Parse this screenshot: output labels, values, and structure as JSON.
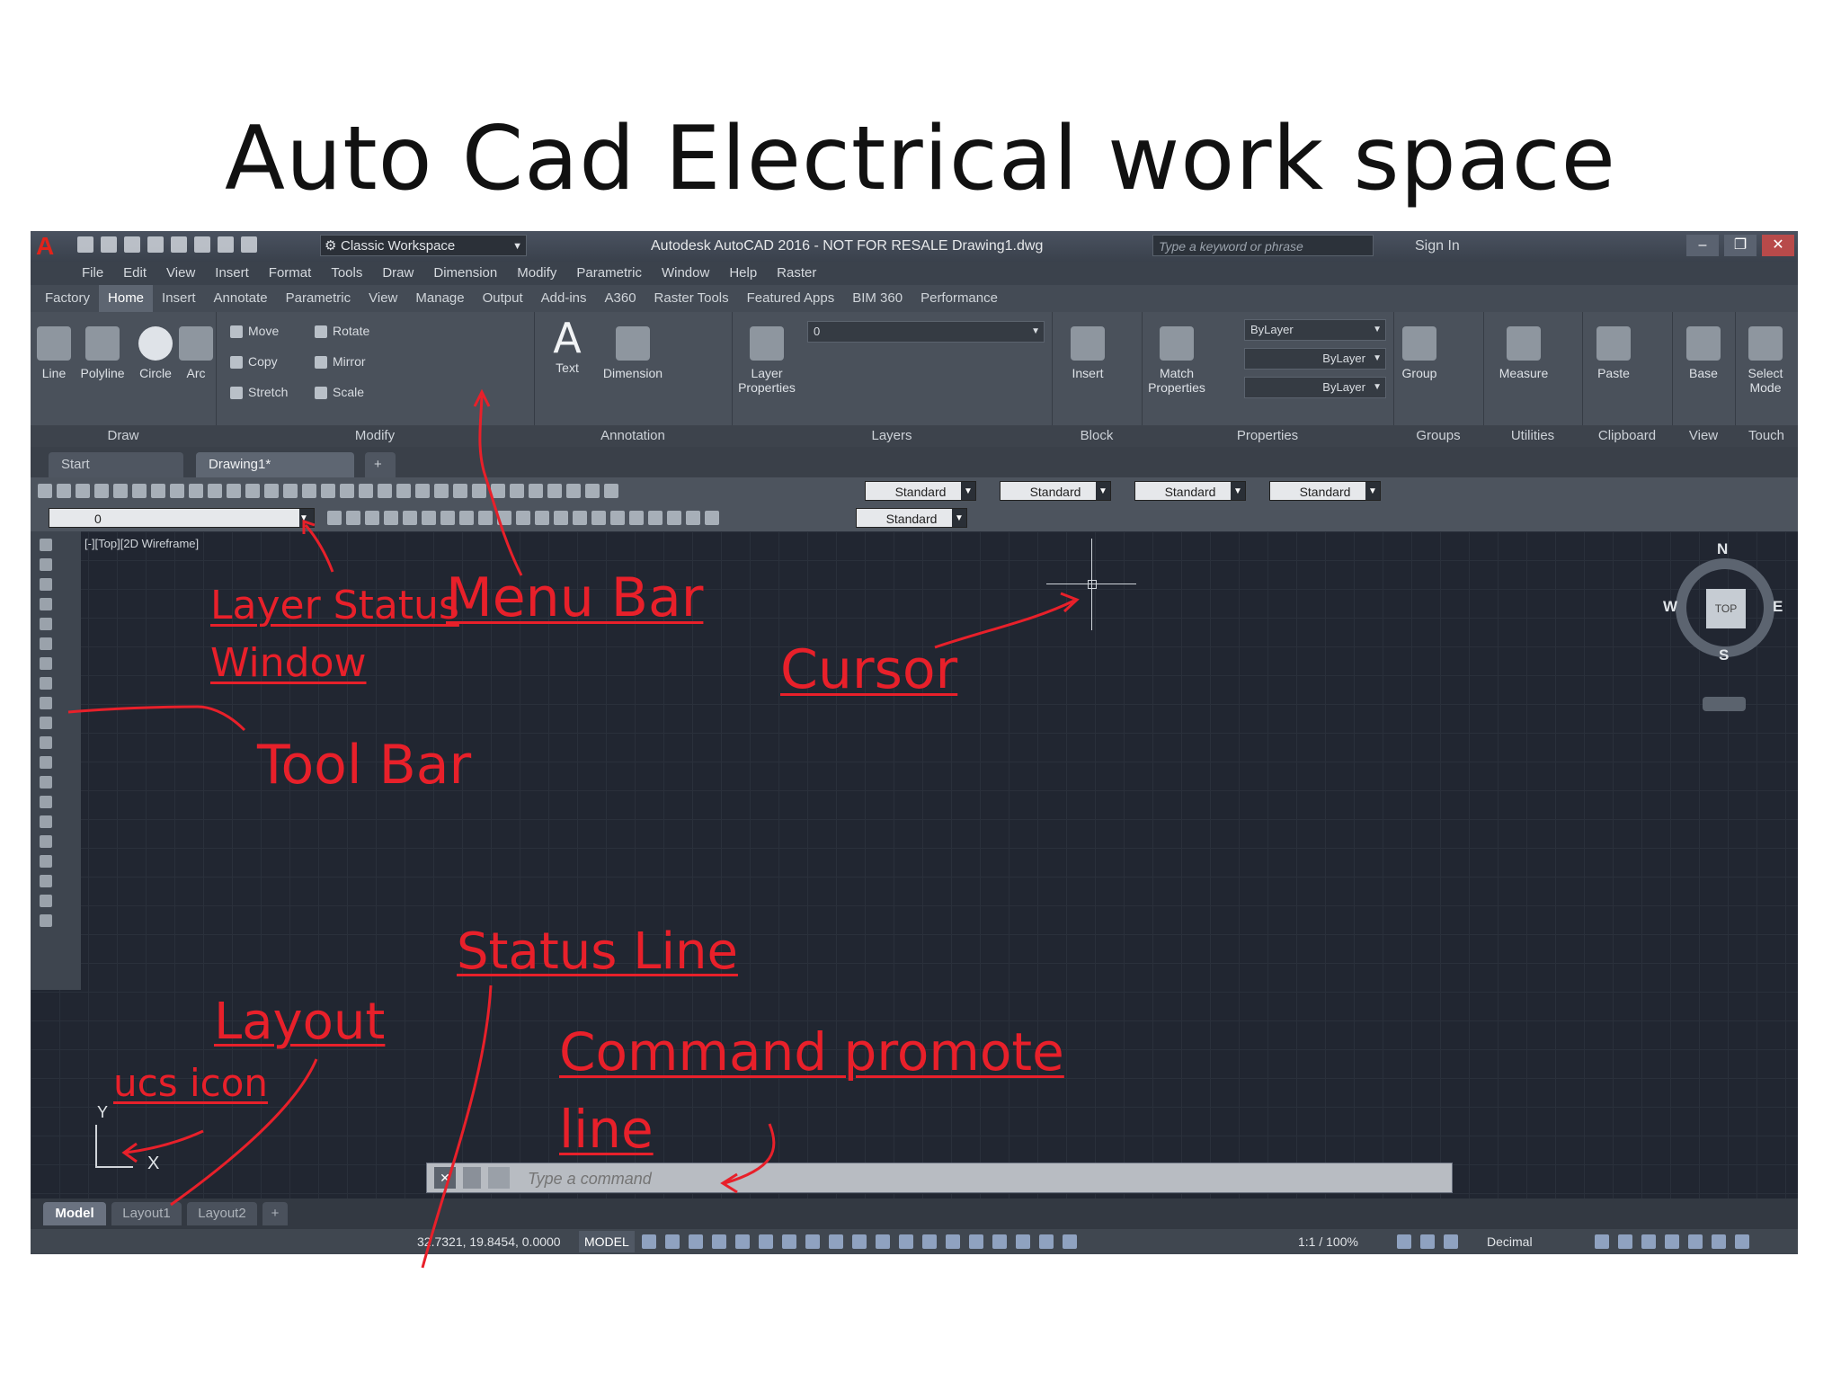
{
  "slide": {
    "title": "Auto Cad Electrical work space"
  },
  "titlebar": {
    "workspace": "Classic Workspace",
    "app_title": "Autodesk AutoCAD 2016 - NOT FOR RESALE    Drawing1.dwg",
    "search_placeholder": "Type a keyword or phrase",
    "signin": "Sign In"
  },
  "menubar": {
    "items": [
      "File",
      "Edit",
      "View",
      "Insert",
      "Format",
      "Tools",
      "Draw",
      "Dimension",
      "Modify",
      "Parametric",
      "Window",
      "Help",
      "Raster"
    ]
  },
  "ribbon_tabs": {
    "items": [
      "Factory",
      "Home",
      "Insert",
      "Annotate",
      "Parametric",
      "View",
      "Manage",
      "Output",
      "Add-ins",
      "A360",
      "Raster Tools",
      "Featured Apps",
      "BIM 360",
      "Performance"
    ],
    "active": "Home"
  },
  "ribbon": {
    "draw": {
      "line": "Line",
      "polyline": "Polyline",
      "circle": "Circle",
      "arc": "Arc",
      "label": "Draw"
    },
    "modify": {
      "move": "Move",
      "rotate": "Rotate",
      "copy": "Copy",
      "mirror": "Mirror",
      "stretch": "Stretch",
      "scale": "Scale",
      "label": "Modify"
    },
    "annotation": {
      "text": "Text",
      "dimension": "Dimension",
      "label": "Annotation"
    },
    "layers": {
      "layer_properties_1": "Layer",
      "layer_properties_2": "Properties",
      "current_layer": "0",
      "label": "Layers"
    },
    "block": {
      "insert": "Insert",
      "label": "Block"
    },
    "properties": {
      "match_1": "Match",
      "match_2": "Properties",
      "color": "ByLayer",
      "linetype": "ByLayer",
      "lineweight": "ByLayer",
      "label": "Properties"
    },
    "groups": {
      "group": "Group",
      "label": "Groups"
    },
    "utilities": {
      "measure": "Measure",
      "label": "Utilities"
    },
    "clipboard": {
      "paste": "Paste",
      "label": "Clipboard"
    },
    "view": {
      "base": "Base",
      "label": "View"
    },
    "touch": {
      "select_1": "Select",
      "select_2": "Mode",
      "label": "Touch"
    }
  },
  "file_tabs": {
    "start": "Start",
    "drawing": "Drawing1*"
  },
  "toolbars": {
    "style1": "Standard",
    "style2": "Standard",
    "style3": "Standard",
    "style4": "Standard",
    "style5": "Standard",
    "layer": "0"
  },
  "canvas": {
    "viewport_label": "[-][Top][2D Wireframe]",
    "compass": {
      "n": "N",
      "s": "S",
      "e": "E",
      "w": "W",
      "top": "TOP"
    },
    "ucs_x": "X",
    "ucs_y": "Y"
  },
  "command": {
    "placeholder": "Type a command"
  },
  "layout_tabs": {
    "model": "Model",
    "layout1": "Layout1",
    "layout2": "Layout2"
  },
  "statusbar": {
    "coords": "32.7321, 19.8454, 0.0000",
    "model": "MODEL",
    "scale": "1:1 / 100%",
    "units": "Decimal"
  },
  "annotations": {
    "layer_status": "Layer Status",
    "window": "Window",
    "menu_bar": "Menu Bar",
    "cursor": "Cursor",
    "tool_bar": "Tool Bar",
    "status_line": "Status Line",
    "layout": "Layout",
    "ucs_icon": "ucs icon",
    "command_promote": "Command promote",
    "line": "line"
  },
  "colors": {
    "annotation": "#e8202a",
    "canvas": "#212631",
    "accent": "#e2231a"
  }
}
